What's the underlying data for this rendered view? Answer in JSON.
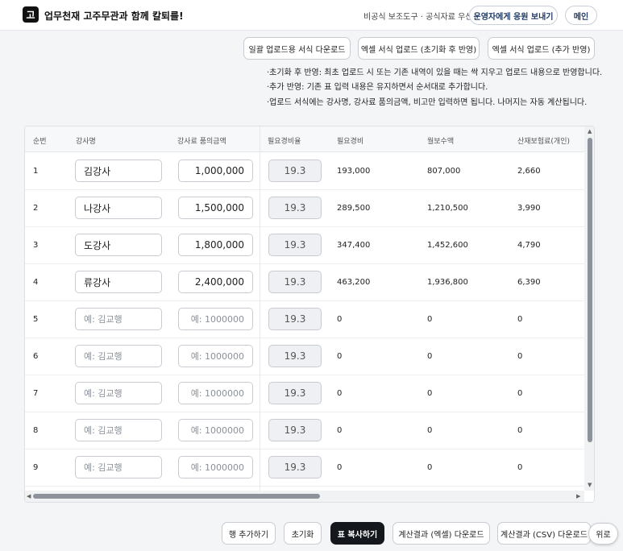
{
  "header": {
    "logo_char": "고",
    "title": "업무천재 고주무관과 함께 칼퇴를!",
    "meta": "비공식 보조도구 · 공식자료 우선",
    "feedback_label": "운영자에게 응원 보내기",
    "main_label": "메인"
  },
  "toolbar": {
    "template_download": "일괄 업로드용 서식 다운로드",
    "upload_reset": "엑셀 서식 업로드 (초기화 후 반영)",
    "upload_append": "엑셀 서식 업로드 (추가 반영)"
  },
  "notes": [
    "·초기화 후 반영: 최초 업로드 시 또는 기존 내역이 있을 때는 싹 지우고 업로드 내용으로 반영합니다.",
    "·추가 반영: 기존 표 입력 내용은 유지하면서 순서대로 추가합니다.",
    "·업로드 서식에는 강사명, 강사료 품의금액, 비고만 입력하면 됩니다. 나머지는 자동 계산됩니다."
  ],
  "table": {
    "headers": [
      "순번",
      "강사명",
      "강사료 품의금액",
      "필요경비율",
      "필요경비",
      "월보수액",
      "산재보험료(개인)"
    ],
    "name_placeholder": "예: 김교행",
    "amount_placeholder": "예: 1000000",
    "rows": [
      {
        "no": "1",
        "name": "김강사",
        "amount": "1,000,000",
        "rate": "19.3",
        "expense": "193,000",
        "monthly": "807,000",
        "insurance": "2,660"
      },
      {
        "no": "2",
        "name": "나강사",
        "amount": "1,500,000",
        "rate": "19.3",
        "expense": "289,500",
        "monthly": "1,210,500",
        "insurance": "3,990"
      },
      {
        "no": "3",
        "name": "도강사",
        "amount": "1,800,000",
        "rate": "19.3",
        "expense": "347,400",
        "monthly": "1,452,600",
        "insurance": "4,790"
      },
      {
        "no": "4",
        "name": "류강사",
        "amount": "2,400,000",
        "rate": "19.3",
        "expense": "463,200",
        "monthly": "1,936,800",
        "insurance": "6,390"
      },
      {
        "no": "5",
        "name": "",
        "amount": "",
        "rate": "19.3",
        "expense": "0",
        "monthly": "0",
        "insurance": "0"
      },
      {
        "no": "6",
        "name": "",
        "amount": "",
        "rate": "19.3",
        "expense": "0",
        "monthly": "0",
        "insurance": "0"
      },
      {
        "no": "7",
        "name": "",
        "amount": "",
        "rate": "19.3",
        "expense": "0",
        "monthly": "0",
        "insurance": "0"
      },
      {
        "no": "8",
        "name": "",
        "amount": "",
        "rate": "19.3",
        "expense": "0",
        "monthly": "0",
        "insurance": "0"
      },
      {
        "no": "9",
        "name": "",
        "amount": "",
        "rate": "19.3",
        "expense": "0",
        "monthly": "0",
        "insurance": "0"
      }
    ]
  },
  "actions": {
    "add_row": "행 추가하기",
    "reset": "초기화",
    "copy_table": "표 복사하기",
    "download_excel": "계산결과 (엑셀) 다운로드",
    "download_csv": "계산결과 (CSV) 다운로드",
    "to_top": "위로"
  }
}
